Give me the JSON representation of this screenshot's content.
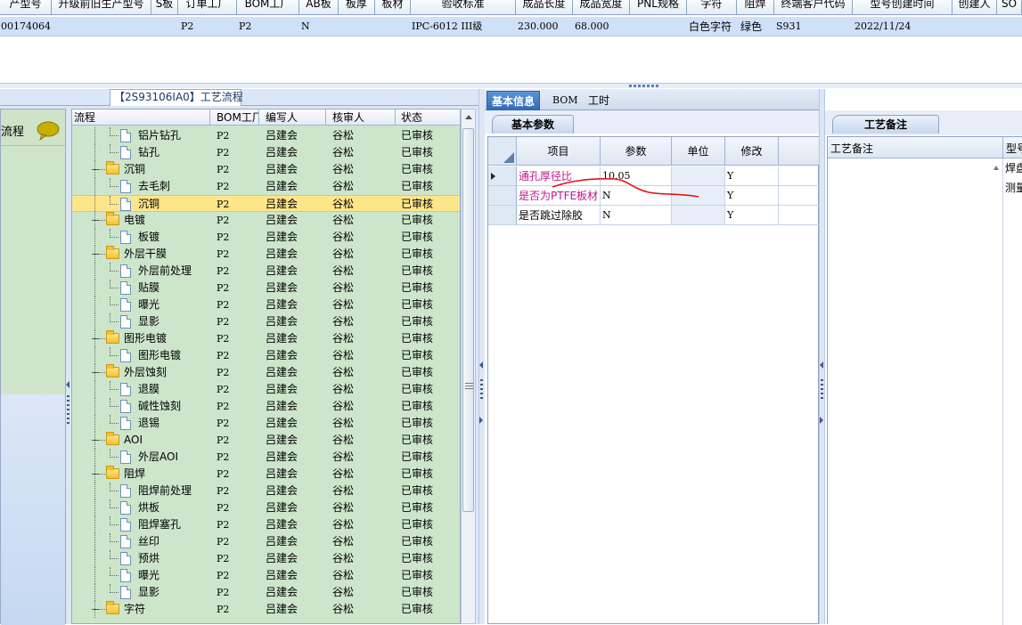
{
  "top_grid": {
    "headers": [
      "产型号",
      "升级前旧生产型号",
      "S板",
      "订单工厂",
      "BOM工厂",
      "AB板",
      "板厚",
      "板材",
      "验收标准",
      "成品长度",
      "成品宽度",
      "PNL规格",
      "字符",
      "阻焊",
      "终端客户代码",
      "型号创建时间",
      "创建人",
      "SO"
    ],
    "row": {
      "part": "00174064",
      "order_factory": "P2",
      "bom_factory": "P2",
      "ab": "N",
      "standard": "IPC-6012 III级",
      "length": "230.000",
      "width": "68.000",
      "char": "白色字符",
      "mask": "绿色",
      "customer": "S931",
      "created": "2022/11/24"
    }
  },
  "left": {
    "tab_title": "【2S93106IA0】工艺流程",
    "nav_label": "流程",
    "tree_headers": [
      "流程",
      "BOM工厂",
      "编写人",
      "核审人",
      "状态"
    ],
    "rows": [
      {
        "name": "铝片钻孔",
        "type": "doc",
        "level": 1,
        "factory": "P2",
        "writer": "吕建会",
        "reviewer": "谷松",
        "status": "已审核"
      },
      {
        "name": "钻孔",
        "type": "doc",
        "level": 1,
        "factory": "P2",
        "writer": "吕建会",
        "reviewer": "谷松",
        "status": "已审核"
      },
      {
        "name": "沉铜",
        "type": "folder",
        "level": 0,
        "factory": "P2",
        "writer": "吕建会",
        "reviewer": "谷松",
        "status": "已审核"
      },
      {
        "name": "去毛刺",
        "type": "doc",
        "level": 1,
        "factory": "P2",
        "writer": "吕建会",
        "reviewer": "谷松",
        "status": "已审核"
      },
      {
        "name": "沉铜",
        "type": "doc",
        "level": 1,
        "factory": "P2",
        "writer": "吕建会",
        "reviewer": "谷松",
        "status": "已审核",
        "selected": true
      },
      {
        "name": "电镀",
        "type": "folder",
        "level": 0,
        "factory": "P2",
        "writer": "吕建会",
        "reviewer": "谷松",
        "status": "已审核"
      },
      {
        "name": "板镀",
        "type": "doc",
        "level": 1,
        "factory": "P2",
        "writer": "吕建会",
        "reviewer": "谷松",
        "status": "已审核"
      },
      {
        "name": "外层干膜",
        "type": "folder",
        "level": 0,
        "factory": "P2",
        "writer": "吕建会",
        "reviewer": "谷松",
        "status": "已审核"
      },
      {
        "name": "外层前处理",
        "type": "doc",
        "level": 1,
        "factory": "P2",
        "writer": "吕建会",
        "reviewer": "谷松",
        "status": "已审核"
      },
      {
        "name": "贴膜",
        "type": "doc",
        "level": 1,
        "factory": "P2",
        "writer": "吕建会",
        "reviewer": "谷松",
        "status": "已审核"
      },
      {
        "name": "曝光",
        "type": "doc",
        "level": 1,
        "factory": "P2",
        "writer": "吕建会",
        "reviewer": "谷松",
        "status": "已审核"
      },
      {
        "name": "显影",
        "type": "doc",
        "level": 1,
        "factory": "P2",
        "writer": "吕建会",
        "reviewer": "谷松",
        "status": "已审核"
      },
      {
        "name": "图形电镀",
        "type": "folder",
        "level": 0,
        "factory": "P2",
        "writer": "吕建会",
        "reviewer": "谷松",
        "status": "已审核"
      },
      {
        "name": "图形电镀",
        "type": "doc",
        "level": 1,
        "factory": "P2",
        "writer": "吕建会",
        "reviewer": "谷松",
        "status": "已审核"
      },
      {
        "name": "外层蚀刻",
        "type": "folder",
        "level": 0,
        "factory": "P2",
        "writer": "吕建会",
        "reviewer": "谷松",
        "status": "已审核"
      },
      {
        "name": "退膜",
        "type": "doc",
        "level": 1,
        "factory": "P2",
        "writer": "吕建会",
        "reviewer": "谷松",
        "status": "已审核"
      },
      {
        "name": "碱性蚀刻",
        "type": "doc",
        "level": 1,
        "factory": "P2",
        "writer": "吕建会",
        "reviewer": "谷松",
        "status": "已审核"
      },
      {
        "name": "退锡",
        "type": "doc",
        "level": 1,
        "factory": "P2",
        "writer": "吕建会",
        "reviewer": "谷松",
        "status": "已审核"
      },
      {
        "name": "AOI",
        "type": "folder",
        "level": 0,
        "factory": "P2",
        "writer": "吕建会",
        "reviewer": "谷松",
        "status": "已审核"
      },
      {
        "name": "外层AOI",
        "type": "doc",
        "level": 1,
        "factory": "P2",
        "writer": "吕建会",
        "reviewer": "谷松",
        "status": "已审核"
      },
      {
        "name": "阻焊",
        "type": "folder",
        "level": 0,
        "factory": "P2",
        "writer": "吕建会",
        "reviewer": "谷松",
        "status": "已审核"
      },
      {
        "name": "阻焊前处理",
        "type": "doc",
        "level": 1,
        "factory": "P2",
        "writer": "吕建会",
        "reviewer": "谷松",
        "status": "已审核"
      },
      {
        "name": "烘板",
        "type": "doc",
        "level": 1,
        "factory": "P2",
        "writer": "吕建会",
        "reviewer": "谷松",
        "status": "已审核"
      },
      {
        "name": "阻焊塞孔",
        "type": "doc",
        "level": 1,
        "factory": "P2",
        "writer": "吕建会",
        "reviewer": "谷松",
        "status": "已审核"
      },
      {
        "name": "丝印",
        "type": "doc",
        "level": 1,
        "factory": "P2",
        "writer": "吕建会",
        "reviewer": "谷松",
        "status": "已审核"
      },
      {
        "name": "预烘",
        "type": "doc",
        "level": 1,
        "factory": "P2",
        "writer": "吕建会",
        "reviewer": "谷松",
        "status": "已审核"
      },
      {
        "name": "曝光",
        "type": "doc",
        "level": 1,
        "factory": "P2",
        "writer": "吕建会",
        "reviewer": "谷松",
        "status": "已审核"
      },
      {
        "name": "显影",
        "type": "doc",
        "level": 1,
        "factory": "P2",
        "writer": "吕建会",
        "reviewer": "谷松",
        "status": "已审核"
      },
      {
        "name": "字符",
        "type": "folder",
        "level": 0,
        "factory": "P2",
        "writer": "吕建会",
        "reviewer": "谷松",
        "status": "已审核"
      }
    ]
  },
  "middle": {
    "tabs": [
      "基本信息",
      "BOM",
      "工时"
    ],
    "subtab": "基本参数",
    "grid_headers": [
      "项目",
      "参数",
      "单位",
      "修改"
    ],
    "rows": [
      {
        "item": "通孔厚径比",
        "value": "10.05",
        "unit": "",
        "edit": "Y",
        "pink": true
      },
      {
        "item": "是否为PTFE板材",
        "value": "N",
        "unit": "",
        "edit": "Y",
        "pink": true
      },
      {
        "item": "是否跳过除胶",
        "value": "N",
        "unit": "",
        "edit": "Y",
        "pink": false
      }
    ]
  },
  "right": {
    "tab": "工艺备注",
    "header": "工艺备注",
    "header2": "型号",
    "side1": "焊盘",
    "side2": "测量"
  },
  "colors": {
    "selection": "#fde68a",
    "tree_bg": "#cde6cb",
    "active_tab": "#2d68b8",
    "pink_text": "#c0178a",
    "annotation": "#e0121b"
  }
}
